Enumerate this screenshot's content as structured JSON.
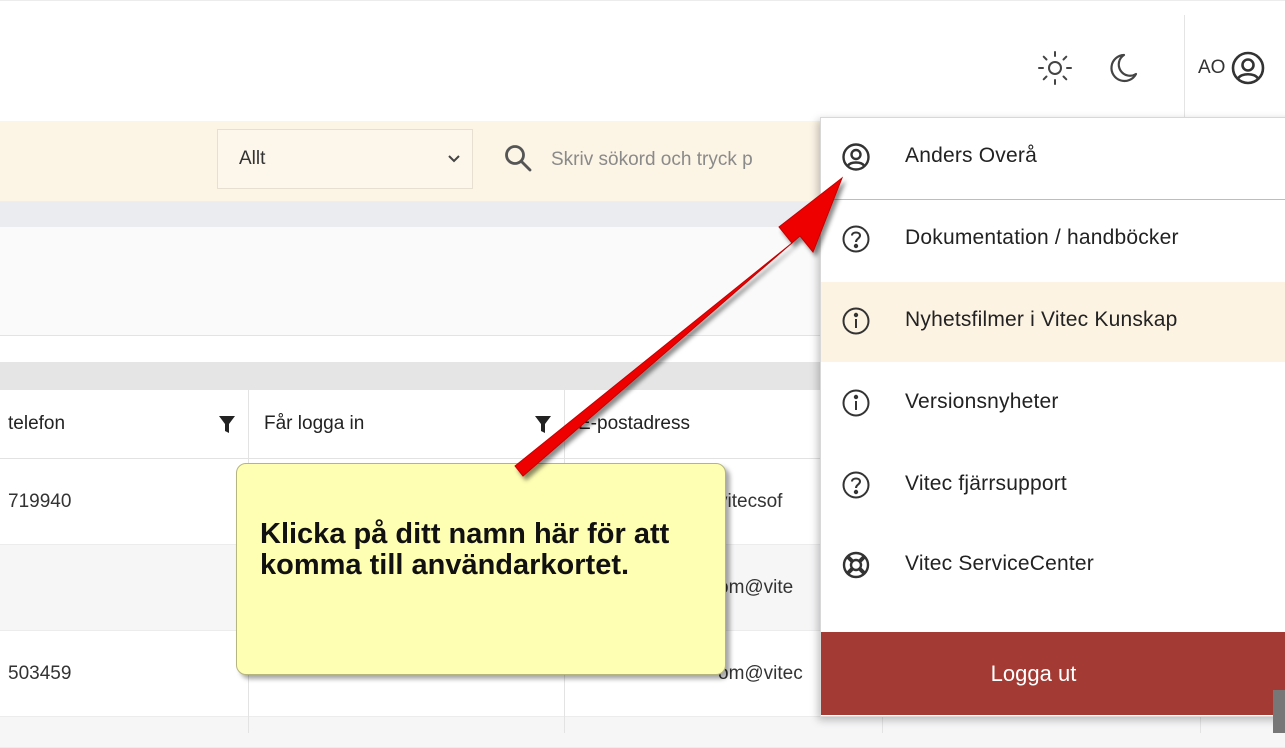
{
  "header": {
    "theme_light_icon": "sun-icon",
    "theme_dark_icon": "moon-icon",
    "user_initials": "AO",
    "user_icon": "user-circle-icon"
  },
  "filter": {
    "scope_value": "Allt",
    "search_placeholder": "Skriv sökord och tryck p"
  },
  "table": {
    "columns": [
      {
        "label": "telefon"
      },
      {
        "label": "Får logga in"
      },
      {
        "label": "E-postadress"
      }
    ],
    "rows": [
      {
        "phone": "719940",
        "email": "vitecsof"
      },
      {
        "phone": "",
        "email": "om@vite"
      },
      {
        "phone": "503459",
        "email": "om@vitec"
      }
    ]
  },
  "menu": {
    "items": [
      {
        "label": "Anders Overå",
        "icon": "user-circle-icon"
      },
      {
        "label": "Dokumentation / handböcker",
        "icon": "help-circle-icon"
      },
      {
        "label": "Nyhetsfilmer i Vitec Kunskap",
        "icon": "info-circle-icon"
      },
      {
        "label": "Versionsnyheter",
        "icon": "info-circle-icon"
      },
      {
        "label": "Vitec fjärrsupport",
        "icon": "help-circle-icon"
      },
      {
        "label": "Vitec ServiceCenter",
        "icon": "lifebuoy-icon"
      }
    ],
    "logout_label": "Logga ut"
  },
  "annotation": {
    "callout_text": "Klicka på ditt namn här för att komma till användarkortet.",
    "arrow_color": "#ee0000",
    "callout_color": "#ffffb3"
  },
  "colors": {
    "logout_bg": "#a33a34",
    "highlight_bg": "#fcf3e3",
    "filterbar_bg": "#fcf4e5"
  }
}
